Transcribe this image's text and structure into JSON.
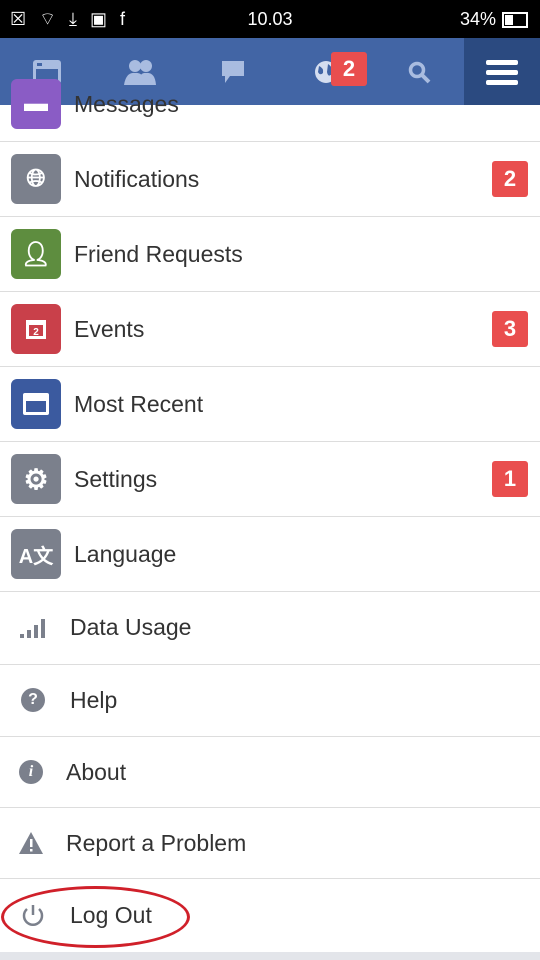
{
  "status_bar": {
    "time": "10.03",
    "battery": "34%",
    "battery_level": 0.34
  },
  "nav": {
    "items": [
      {
        "icon": "news-feed-icon"
      },
      {
        "icon": "friends-icon"
      },
      {
        "icon": "messages-icon"
      },
      {
        "icon": "globe-notifications-icon",
        "badge": "2"
      },
      {
        "icon": "search-icon"
      },
      {
        "icon": "menu-icon"
      }
    ]
  },
  "menu": {
    "items": [
      {
        "label": "Messages",
        "color": "#8a5cc5"
      },
      {
        "label": "Notifications",
        "badge": "2",
        "color": "#7b808c"
      },
      {
        "label": "Friend Requests",
        "color": "#5e8d3f"
      },
      {
        "label": "Events",
        "badge": "3",
        "color": "#c9404a"
      },
      {
        "label": "Most Recent",
        "color": "#3b5a9f"
      },
      {
        "label": "Settings",
        "badge": "1",
        "color": "#7b808c"
      },
      {
        "label": "Language",
        "color": "#7b808c"
      }
    ],
    "secondary": [
      {
        "label": "Data Usage"
      },
      {
        "label": "Help"
      },
      {
        "label": "About"
      },
      {
        "label": "Report a Problem"
      },
      {
        "label": "Log Out"
      }
    ]
  },
  "annotation": {
    "color": "#d0202a",
    "target": "Log Out"
  }
}
